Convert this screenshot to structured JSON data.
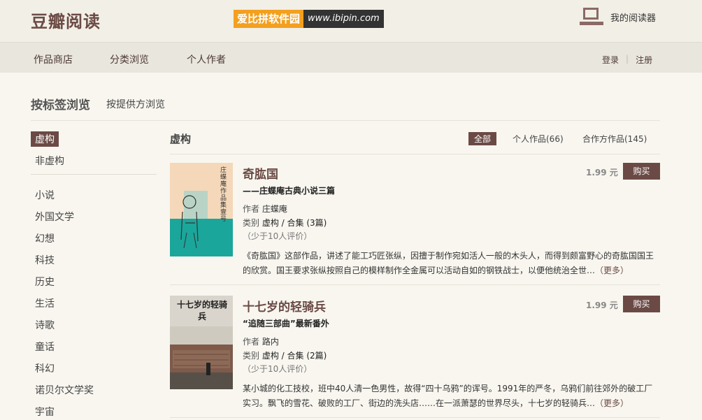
{
  "header": {
    "brand": "豆瓣阅读",
    "watermark_cn": "爱比拼软件园",
    "watermark_en": "www.ibipin.com",
    "reader_label": "我的阅读器"
  },
  "nav": {
    "items": [
      "作品商店",
      "分类浏览",
      "个人作者"
    ],
    "login": "登录",
    "separator": "|",
    "register": "注册"
  },
  "browse": {
    "active_tab": "按标签浏览",
    "alt_tab": "按提供方浏览"
  },
  "sidebar": {
    "top": [
      "虚构",
      "非虚构"
    ],
    "tags": [
      "小说",
      "外国文学",
      "幻想",
      "科技",
      "历史",
      "生活",
      "诗歌",
      "童话",
      "科幻",
      "诺贝尔文学奖",
      "宇宙"
    ]
  },
  "list": {
    "title": "虚构",
    "filter_all": "全部",
    "filter_personal": "个人作品(66)",
    "filter_collab": "合作方作品(145)"
  },
  "books": [
    {
      "title": "奇肱国",
      "subtitle": "——庄蝶庵古典小说三篇",
      "author_label": "作者",
      "author": "庄蝶庵",
      "category_label": "类别",
      "category": "虚构 / 合集 (3篇)",
      "rating": "（少于10人评价）",
      "description": "《奇肱国》这部作品，讲述了能工巧匠张纵，因擅于制作宛如活人一般的木头人，而得到颇富野心的奇肱国国王的欣赏。国王要求张纵按照自己的模样制作全金属可以活动自如的钢铁战士，以便他统治全世…",
      "more": "（更多）",
      "price": "1.99 元",
      "buy": "购买",
      "cover_text": "庄蝶庵作品集壹号"
    },
    {
      "title": "十七岁的轻骑兵",
      "subtitle": "“追随三部曲”最新番外",
      "author_label": "作者",
      "author": "路内",
      "category_label": "类别",
      "category": "虚构 / 合集 (2篇)",
      "rating": "（少于10人评价）",
      "description": "某小城的化工技校，班中40人清一色男性，故得“四十乌鸦”的诨号。1991年的严冬，乌鸦们前往郊外的破工厂实习。飘飞的雪花、破败的工厂、街边的洗头店……在一派萧瑟的世界尽头，十七岁的轻骑兵…",
      "more": "（更多）",
      "price": "1.99 元",
      "buy": "购买",
      "cover_text": "十七岁的轻骑兵"
    }
  ],
  "colors": {
    "brand": "#6b4a45",
    "watermark_orange": "#f3a01f",
    "teal": "#1ba69b"
  }
}
